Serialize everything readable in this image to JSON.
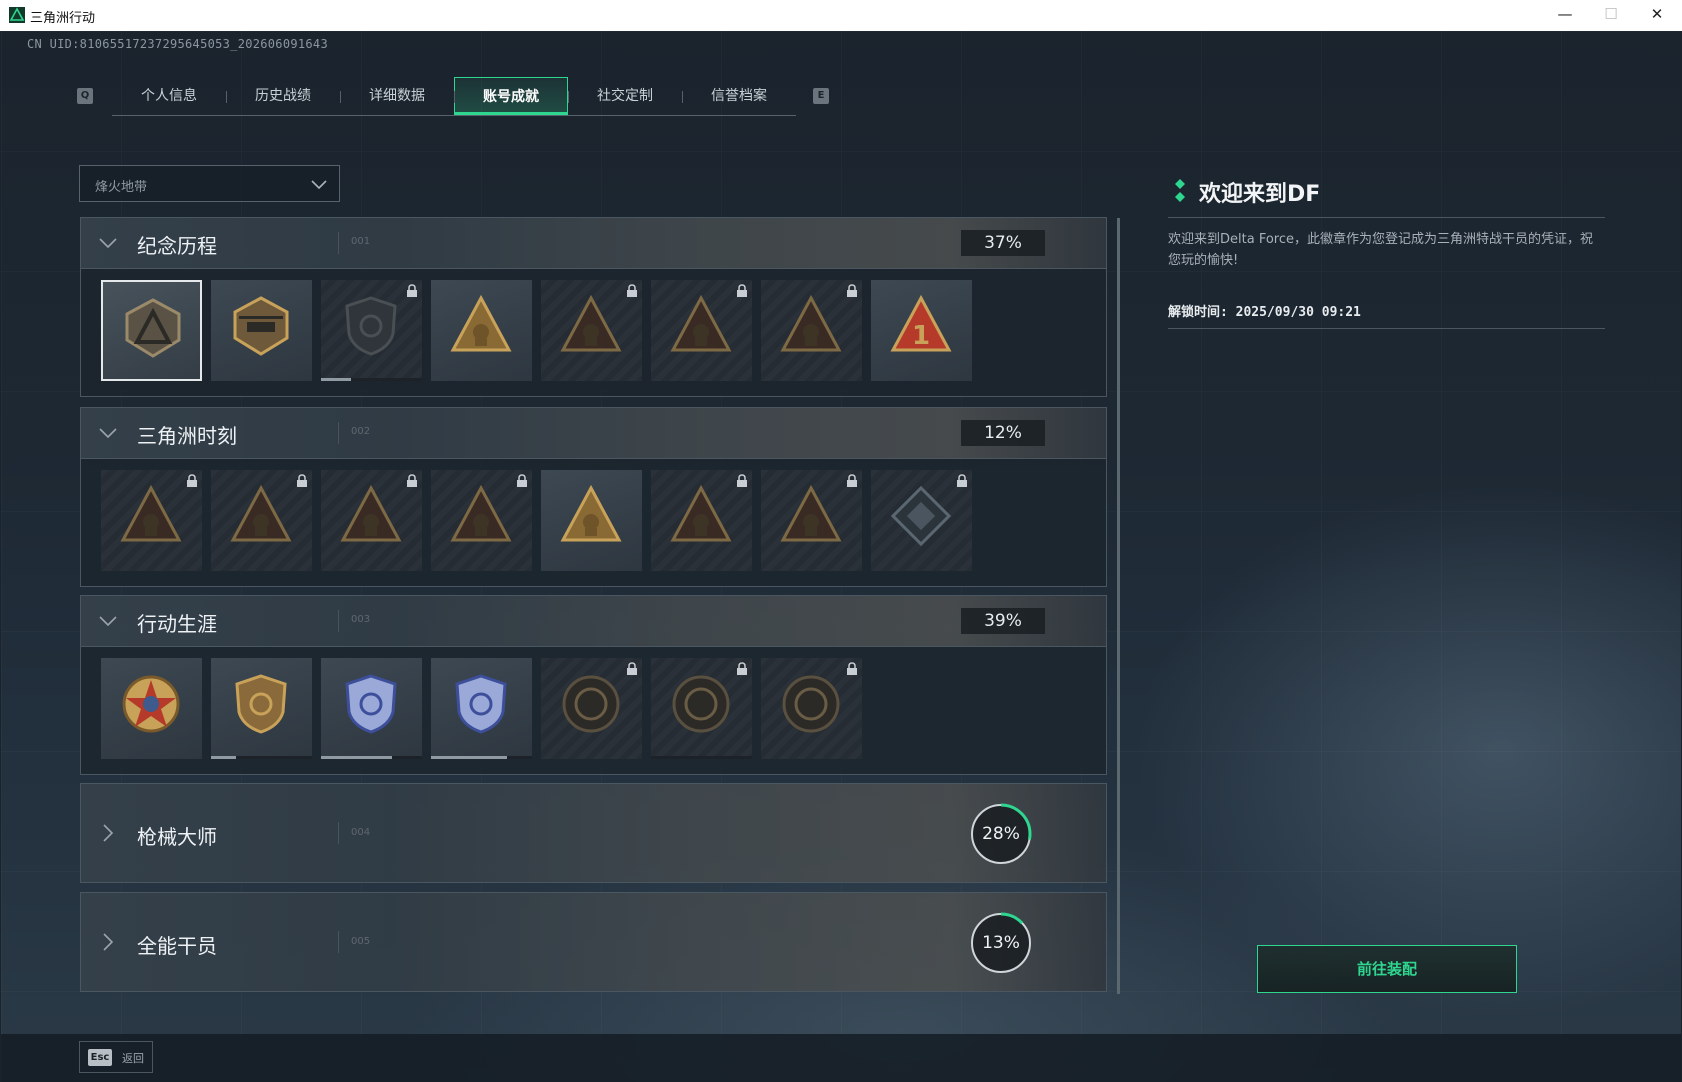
{
  "window": {
    "title": "三角洲行动",
    "controls": {
      "minimize": "—",
      "maximize": "☐",
      "close": "✕"
    }
  },
  "uid": "CN UID:81065517237295645053_202606091643",
  "tabs": {
    "prev_key": "Q",
    "next_key": "E",
    "items": [
      {
        "label": "个人信息",
        "active": false
      },
      {
        "label": "历史战绩",
        "active": false
      },
      {
        "label": "详细数据",
        "active": false
      },
      {
        "label": "账号成就",
        "active": true
      },
      {
        "label": "社交定制",
        "active": false
      },
      {
        "label": "信誉档案",
        "active": false
      }
    ]
  },
  "mode_select": {
    "value": "烽火地带"
  },
  "sections": [
    {
      "name": "纪念历程",
      "num": "001",
      "percent": "37%",
      "expanded": true,
      "badges": [
        {
          "icon": "delta-triangle-badge",
          "locked": false,
          "selected": true
        },
        {
          "icon": "helicopter-badge",
          "locked": false
        },
        {
          "icon": "dark-shield-badge",
          "locked": true,
          "progress": 0.3
        },
        {
          "icon": "gold-triangle-badge",
          "locked": false
        },
        {
          "icon": "operator-triangle-badge",
          "locked": true
        },
        {
          "icon": "helmet-triangle-badge",
          "locked": true
        },
        {
          "icon": "skull-crossed-guns-badge",
          "locked": true
        },
        {
          "icon": "red-number-one-badge",
          "locked": false
        }
      ]
    },
    {
      "name": "三角洲时刻",
      "num": "002",
      "percent": "12%",
      "expanded": true,
      "badges": [
        {
          "icon": "crate-triangle-badge",
          "locked": true
        },
        {
          "icon": "safe-triangle-badge",
          "locked": true
        },
        {
          "icon": "soldier-triangle-badge",
          "locked": true
        },
        {
          "icon": "hands-triangle-badge",
          "locked": true
        },
        {
          "icon": "team-triangle-badge",
          "locked": false
        },
        {
          "icon": "winged-triangle-badge",
          "locked": true
        },
        {
          "icon": "fish-triangle-badge",
          "locked": true
        },
        {
          "icon": "diamond-cube-badge",
          "locked": true
        }
      ]
    },
    {
      "name": "行动生涯",
      "num": "003",
      "percent": "39%",
      "expanded": true,
      "badges": [
        {
          "icon": "star-medal-badge",
          "locked": false
        },
        {
          "icon": "bronze-shield-badge",
          "locked": false,
          "progress": 0.25
        },
        {
          "icon": "silver-shield-badge",
          "locked": false,
          "progress": 0.7
        },
        {
          "icon": "diamond-shield-badge",
          "locked": false,
          "progress": 0.75
        },
        {
          "icon": "round-ring-badge",
          "locked": true
        },
        {
          "icon": "round-skull-badge",
          "locked": true,
          "progress": 0.0
        },
        {
          "icon": "round-eye-badge",
          "locked": true
        }
      ]
    },
    {
      "name": "枪械大师",
      "num": "004",
      "percent": "28%",
      "progress": 0.28,
      "expanded": false
    },
    {
      "name": "全能干员",
      "num": "005",
      "percent": "13%",
      "progress": 0.13,
      "expanded": false
    }
  ],
  "detail": {
    "title": "欢迎来到DF",
    "description": "欢迎来到Delta Force，此徽章作为您登记成为三角洲特战干员的凭证，祝您玩的愉快!",
    "unlock_time": "解锁时间: 2025/09/30 09:21",
    "equip_button": "前往装配"
  },
  "footer": {
    "esc_key": "Esc",
    "back_label": "返回"
  },
  "colors": {
    "accent": "#2fd68f",
    "panel_border": "#4a5660",
    "badge_gold": "#c9a25a",
    "badge_red": "#b53a2a"
  }
}
